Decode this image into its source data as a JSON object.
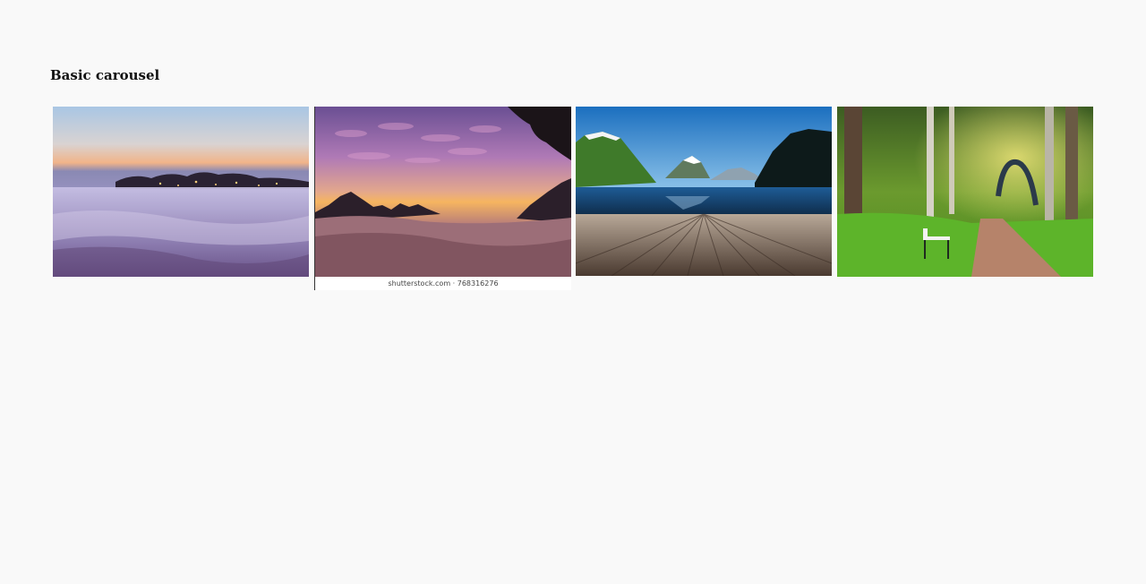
{
  "page": {
    "title": "Basic carousel"
  },
  "carousel": {
    "slides": [
      {
        "name": "foggy-city-dawn"
      },
      {
        "name": "mountains-above-clouds-sunset",
        "watermark": "shutterstock.com · 768316276"
      },
      {
        "name": "lake-mountains-wooden-deck"
      },
      {
        "name": "forest-park-path-bench"
      }
    ]
  },
  "colors": {
    "background": "#f9f9f9",
    "title": "#111111"
  }
}
